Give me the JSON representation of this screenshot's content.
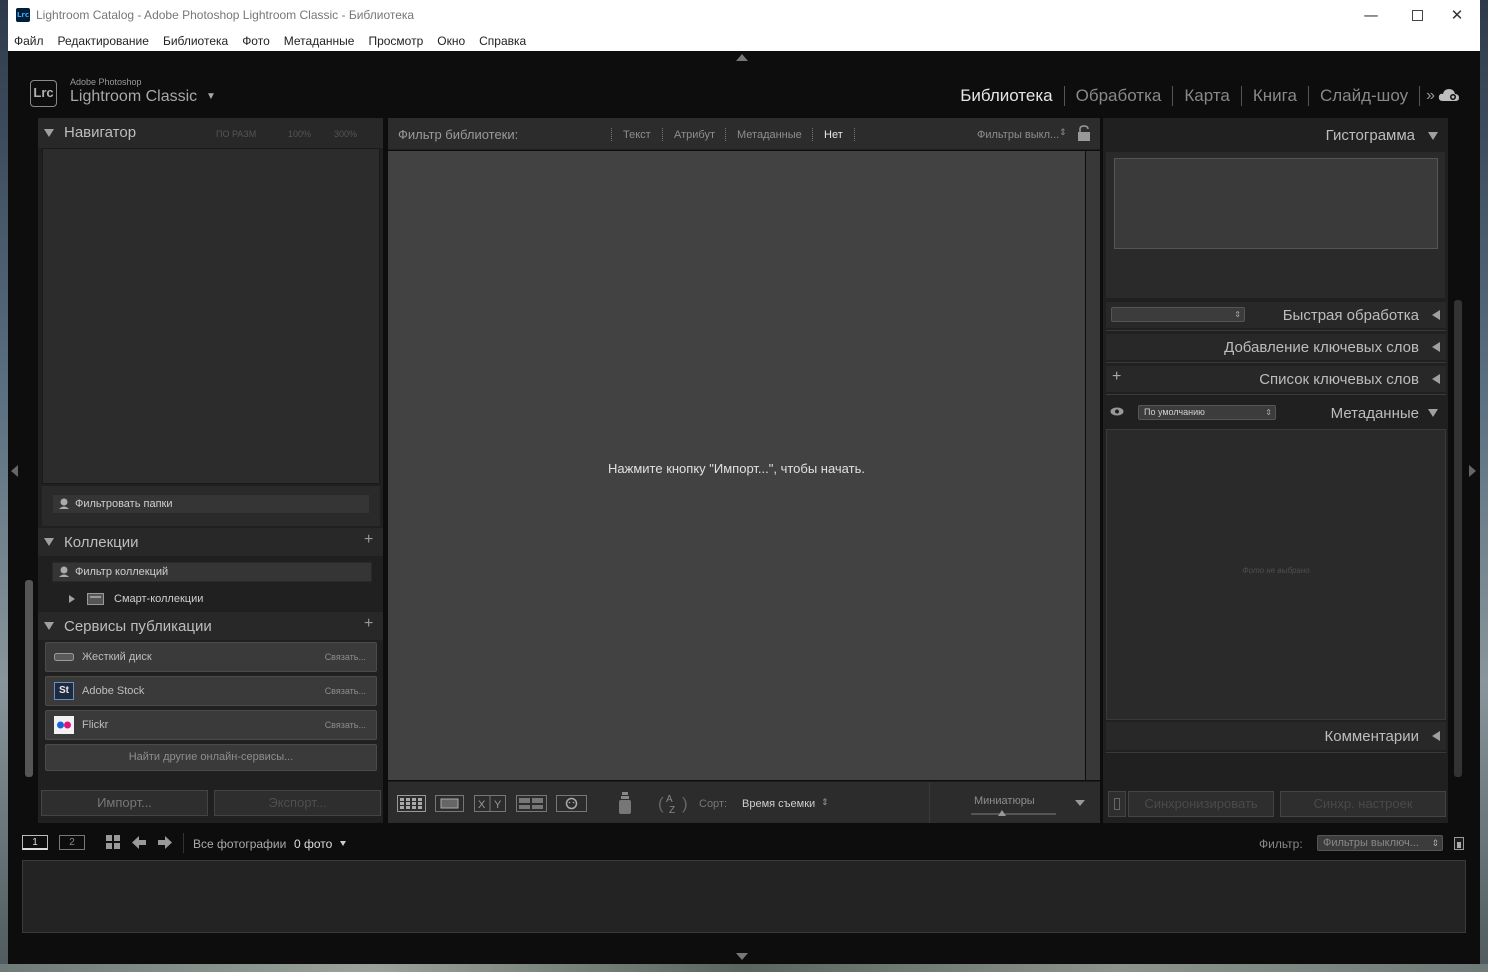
{
  "window": {
    "title": "Lightroom Catalog - Adobe Photoshop Lightroom Classic - Библиотека",
    "icon_text": "Lrc",
    "controls": [
      "minimize-icon",
      "maximize-icon",
      "close-icon"
    ]
  },
  "menu": [
    "Файл",
    "Редактирование",
    "Библиотека",
    "Фото",
    "Метаданные",
    "Просмотр",
    "Окно",
    "Справка"
  ],
  "identity": {
    "logo_text": "Lrc",
    "small": "Adobe Photoshop",
    "big": "Lightroom Classic",
    "caret": "▼"
  },
  "modules": {
    "items": [
      "Библиотека",
      "Обработка",
      "Карта",
      "Книга",
      "Слайд-шоу"
    ],
    "active": "Библиотека",
    "more": "»",
    "cloud_icon": "cloud-sync-icon"
  },
  "left_panel": {
    "navigator": {
      "title": "Навигатор",
      "zoom_options": [
        "ПО РАЗМ",
        "100%",
        "300%"
      ]
    },
    "folders": {
      "filter_placeholder": "Фильтровать папки"
    },
    "collections": {
      "title": "Коллекции",
      "filter_placeholder": "Фильтр коллекций",
      "items": [
        "Смарт-коллекции"
      ]
    },
    "publish": {
      "title": "Сервисы публикации",
      "services": [
        {
          "name": "Жесткий диск",
          "action": "Связать...",
          "icon": "hard-drive-icon"
        },
        {
          "name": "Adobe Stock",
          "action": "Связать...",
          "icon": "adobe-stock-icon",
          "icon_text": "St"
        },
        {
          "name": "Flickr",
          "action": "Связать...",
          "icon": "flickr-icon"
        }
      ],
      "find_more": "Найти другие онлайн-сервисы..."
    },
    "import_button": "Импорт...",
    "export_button": "Экспорт..."
  },
  "filter_bar": {
    "title": "Фильтр библиотеки:",
    "tabs": [
      "Текст",
      "Атрибут",
      "Метаданные",
      "Нет"
    ],
    "active_tab": "Нет",
    "preset": "Фильтры выкл...",
    "lock_icon": "lock-icon"
  },
  "grid": {
    "empty_message": "Нажмите кнопку \"Импорт...\", чтобы начать."
  },
  "toolbar": {
    "view_icons": [
      "grid-view-icon",
      "loupe-view-icon",
      "compare-view-icon",
      "survey-view-icon",
      "people-view-icon"
    ],
    "compare_text": "X|Y",
    "sort_label": "Сорт:",
    "sort_value": "Время съемки",
    "thumbnails_label": "Миниатюры"
  },
  "right_panel": {
    "histogram": "Гистограмма",
    "quick_develop": "Быстрая обработка",
    "keywording": "Добавление ключевых слов",
    "keyword_list": "Список ключевых слов",
    "metadata": "Метаданные",
    "metadata_preset": "По умолчанию",
    "no_photo": "Фото не выбрано",
    "comments": "Комментарии",
    "sync_button": "Синхронизировать",
    "sync_settings_button": "Синхр. настроек"
  },
  "filmstrip": {
    "screens": [
      "1",
      "2"
    ],
    "source": "Все фотографии",
    "count": "0 фото",
    "filter_label": "Фильтр:",
    "filter_value": "Фильтры выключ..."
  }
}
